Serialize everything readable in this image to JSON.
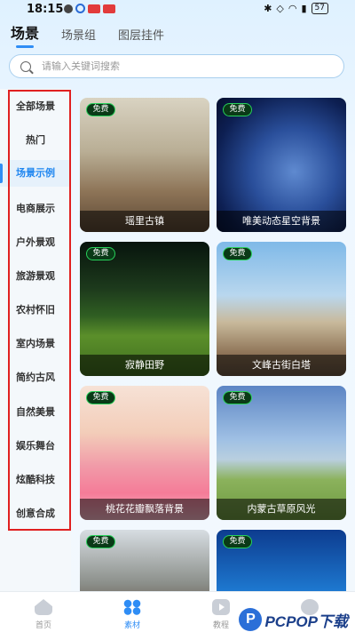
{
  "status_bar": {
    "time": "18:15",
    "battery": "57"
  },
  "top_tabs": [
    "场景",
    "场景组",
    "图层挂件"
  ],
  "search": {
    "placeholder": "请输入关键词搜索"
  },
  "categories": [
    "全部场景",
    "热门",
    "场景示例",
    "电商展示",
    "户外景观",
    "旅游景观",
    "农村怀旧",
    "室内场景",
    "简约古风",
    "自然美景",
    "娱乐舞台",
    "炫酷科技",
    "创意合成"
  ],
  "active_category": "场景示例",
  "badge_label": "免费",
  "cards": [
    {
      "title": "瑶里古镇"
    },
    {
      "title": "唯美动态星空背景"
    },
    {
      "title": "寂静田野"
    },
    {
      "title": "文峰古街白塔"
    },
    {
      "title": "桃花花瓣飘落背景"
    },
    {
      "title": "内蒙古草原风光"
    },
    {
      "title": ""
    },
    {
      "title": ""
    }
  ],
  "bottom_nav": [
    "首页",
    "素材",
    "教程",
    ""
  ],
  "watermark": {
    "text": "PCPOP下载",
    "logo": "P"
  }
}
